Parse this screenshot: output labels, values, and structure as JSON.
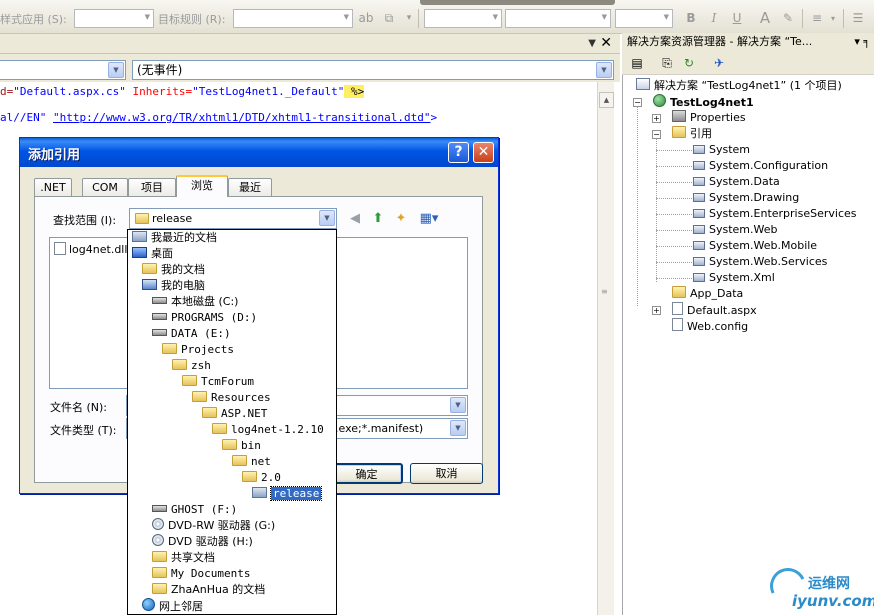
{
  "toolbar": {
    "style_apply_label": "样式应用 (S):",
    "target_rule_label": "目标规则 (R):",
    "bold": "B",
    "italic": "I",
    "underline": "U"
  },
  "editor": {
    "object_combo_value": "",
    "event_combo_value": "(无事件)",
    "code_lines": [
      {
        "prefix": "d=",
        "value1": "\"Default.aspx.cs\"",
        "mid": " Inherits=",
        "value2": "\"TestLog4net1._Default\"",
        "tail": " %>"
      },
      {
        "prefix": "al//EN\" ",
        "value1": "\"http://www.w3.org/TR/xhtml1/DTD/xhtml1-transitional.dtd\"",
        "tail": ">"
      }
    ]
  },
  "solution_explorer": {
    "title": "解决方案资源管理器 - 解决方案 “Te...",
    "solution_label": "解决方案 “TestLog4net1” (1 个项目)",
    "project_label": "TestLog4net1",
    "properties_label": "Properties",
    "references_label": "引用",
    "references": [
      "System",
      "System.Configuration",
      "System.Data",
      "System.Drawing",
      "System.EnterpriseServices",
      "System.Web",
      "System.Web.Mobile",
      "System.Web.Services",
      "System.Xml"
    ],
    "app_data_label": "App_Data",
    "default_aspx_label": "Default.aspx",
    "web_config_label": "Web.config"
  },
  "dialog": {
    "title": "添加引用",
    "help_glyph": "?",
    "close_glyph": "✕",
    "tabs": [
      ".NET",
      "COM",
      "项目",
      "浏览",
      "最近"
    ],
    "active_tab": "浏览",
    "look_in_label": "查找范围 (I):",
    "look_in_value": "release",
    "file_list_items": [
      "log4net.dll"
    ],
    "filename_label": "文件名 (N):",
    "filename_value": "",
    "filetype_label": "文件类型 (T):",
    "filetype_value": ".exe;*.manifest)",
    "ok_label": "确定",
    "cancel_label": "取消"
  },
  "look_in_list": [
    {
      "label": "我最近的文档",
      "icon": "recent-docs-icon"
    },
    {
      "label": "桌面",
      "icon": "desktop-icon"
    },
    {
      "label": "我的文档",
      "icon": "folder-icon"
    },
    {
      "label": "我的电脑",
      "icon": "computer-icon"
    },
    {
      "label": "本地磁盘 (C:)",
      "icon": "drive-icon"
    },
    {
      "label": "PROGRAMS (D:)",
      "icon": "drive-icon"
    },
    {
      "label": "DATA (E:)",
      "icon": "drive-icon"
    },
    {
      "label": "Projects",
      "icon": "folder-icon"
    },
    {
      "label": "zsh",
      "icon": "folder-icon"
    },
    {
      "label": "TcmForum",
      "icon": "folder-icon"
    },
    {
      "label": "Resources",
      "icon": "folder-icon"
    },
    {
      "label": "ASP.NET",
      "icon": "folder-icon"
    },
    {
      "label": "log4net-1.2.10",
      "icon": "folder-icon"
    },
    {
      "label": "bin",
      "icon": "folder-icon"
    },
    {
      "label": "net",
      "icon": "folder-icon"
    },
    {
      "label": "2.0",
      "icon": "folder-icon"
    },
    {
      "label": "release",
      "icon": "open-folder-icon",
      "selected": true
    },
    {
      "label": "GHOST (F:)",
      "icon": "drive-icon"
    },
    {
      "label": "DVD-RW 驱动器 (G:)",
      "icon": "cd-drive-icon"
    },
    {
      "label": "DVD 驱动器 (H:)",
      "icon": "cd-drive-icon"
    },
    {
      "label": "共享文档",
      "icon": "folder-icon"
    },
    {
      "label": "My Documents",
      "icon": "folder-icon"
    },
    {
      "label": "ZhaAnHua 的文档",
      "icon": "folder-icon"
    },
    {
      "label": "网上邻居",
      "icon": "network-icon"
    }
  ],
  "watermark": {
    "name_cn": "运维网",
    "domain": "iyunv.com"
  }
}
